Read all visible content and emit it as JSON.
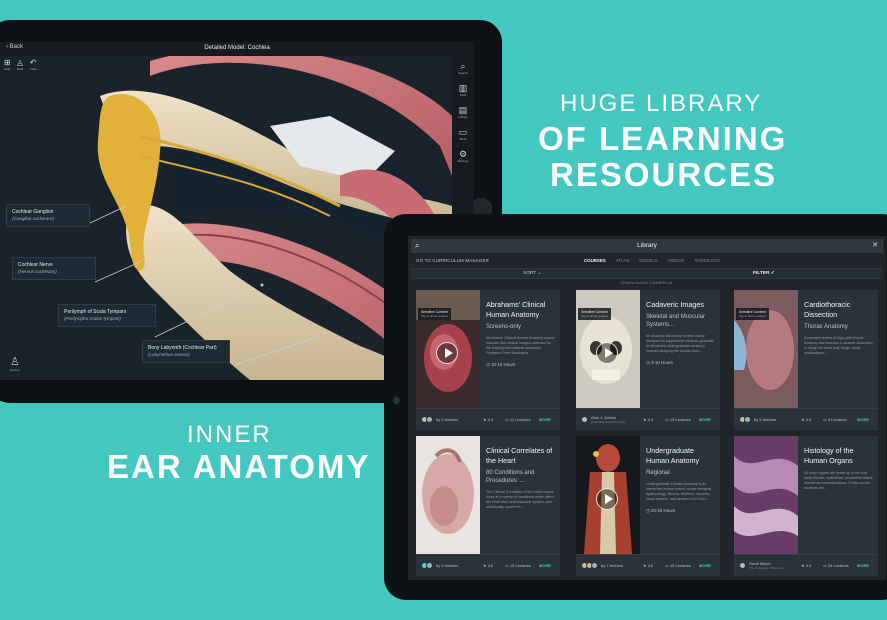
{
  "marketing": {
    "line1": "HUGE LIBRARY",
    "line2": "OF LEARNING",
    "line3": "RESOURCES",
    "line4": "INNER",
    "line5": "EAR ANATOMY"
  },
  "viewer": {
    "back_label": "Back",
    "title": "Detailed Model: Cochlea",
    "tools": [
      {
        "icon": "hide-icon",
        "glyph": "⊞",
        "label": "Hide"
      },
      {
        "icon": "fade-icon",
        "glyph": "◬",
        "label": "Fade"
      },
      {
        "icon": "undo-icon",
        "glyph": "↶",
        "label": "Undo"
      }
    ],
    "right_tools": [
      {
        "icon": "search-icon",
        "glyph": "⌕",
        "label": "Search"
      },
      {
        "icon": "tools-icon",
        "glyph": "▥",
        "label": "Tools"
      },
      {
        "icon": "library-icon",
        "glyph": "▤",
        "label": "Library"
      },
      {
        "icon": "book-icon",
        "glyph": "▭",
        "label": "Book"
      },
      {
        "icon": "settings-icon",
        "glyph": "⚙",
        "label": "Settings"
      }
    ],
    "person_label": "Models",
    "labels": [
      {
        "name": "Cochlear Ganglion",
        "latin": "(Ganglion cochleare)"
      },
      {
        "name": "Cochlear Nerve",
        "latin": "(Nervus cochlearis)"
      },
      {
        "name": "Perilymph of Scala Tympani",
        "latin": "(Perilympha scalae tympani)"
      },
      {
        "name": "Bony Labyrinth (Cochlear Part)",
        "latin": "(Labyrinthus osseus)"
      }
    ]
  },
  "library": {
    "title": "Library",
    "curriculum": "GO TO CURRICULUM MANAGER",
    "tabs": [
      "COURSES",
      "ATLAS",
      "MODELS",
      "VIDEOS",
      "RADIOLOGY"
    ],
    "active_tab": "COURSES",
    "sort_label": "SORT",
    "filter_label": "FILTER",
    "count_text": "18 items found in COMMERCIAL",
    "more_label": "MORE",
    "sensitive_label": "Sensitive Content",
    "sensitive_sub": "Tap to show content",
    "cards": [
      {
        "title": "Abrahams' Clinical Human Anatomy",
        "subtitle": "Screens-only",
        "desc": "Abrahams' Clinical Human Anatomy course includes 500 clinical images collected by the leading international anatomist Professor Peter Abrahams...",
        "duration": "10-15 Hours",
        "author": "by 2 Authors",
        "author_sub": "",
        "rating": "4.4",
        "lectures": "11 Lectures",
        "sensitive": true
      },
      {
        "title": "Cadaveric Images",
        "subtitle": "Skeletal and Muscular Systems...",
        "desc": "80 anatomy laboratory review course designed to supplement medical, graduate, or advanced undergraduate anatomy courses studying the human form...",
        "duration": "3-10 Hours",
        "author": "Alan J. Detton",
        "author_sub": "Columbia University Medi...",
        "rating": "4.4",
        "lectures": "19 Lectures",
        "sensitive": true
      },
      {
        "title": "Cardiothoracic Dissection",
        "subtitle": "Thorax Anatomy",
        "desc": "A narrated review of high-yield thorax anatomy that features a cadaver dissection to study the chest wall, lungs, heart, mediastinum...",
        "duration": "",
        "author": "by 2 Authors",
        "author_sub": "",
        "rating": "4.5",
        "lectures": "4 Lectures",
        "sensitive": true
      },
      {
        "title": "Clinical Correlates of the Heart",
        "subtitle": "80 Conditions and Procedures: ...",
        "desc": "The Clinical Correlates of the Heart course looks at a variety of conditions which affect the heart and cardiovascular system, and additionally covers fre...",
        "duration": "",
        "author": "by 2 Authors",
        "author_sub": "",
        "rating": "4.6",
        "lectures": "10 Lectures",
        "sensitive": false
      },
      {
        "title": "Undergraduate Human Anatomy",
        "subtitle": "Regional",
        "desc": "Undergraduate Human Anatomy is an interactive lecture based course studying systemology, tissues, skeleton, muscles, blood vessels, and nerves of the hum...",
        "duration": "20-25 Hours",
        "author": "by 7 Authors",
        "author_sub": "",
        "rating": "4.6",
        "lectures": "40 Lectures",
        "sensitive": false
      },
      {
        "title": "Histology of the Human Organs",
        "subtitle": "",
        "desc": "All body organs are made up of the four basic tissues: epithelium, connective tissue, muscle and nervous tissue. In this course, students are...",
        "duration": "",
        "author": "Geoff Meyer",
        "author_sub": "The University of Western...",
        "rating": "4.3",
        "lectures": "34 Lectures",
        "sensitive": false
      }
    ]
  },
  "colors": {
    "background": "#45c7c1",
    "accent": "#2fd3c4"
  }
}
